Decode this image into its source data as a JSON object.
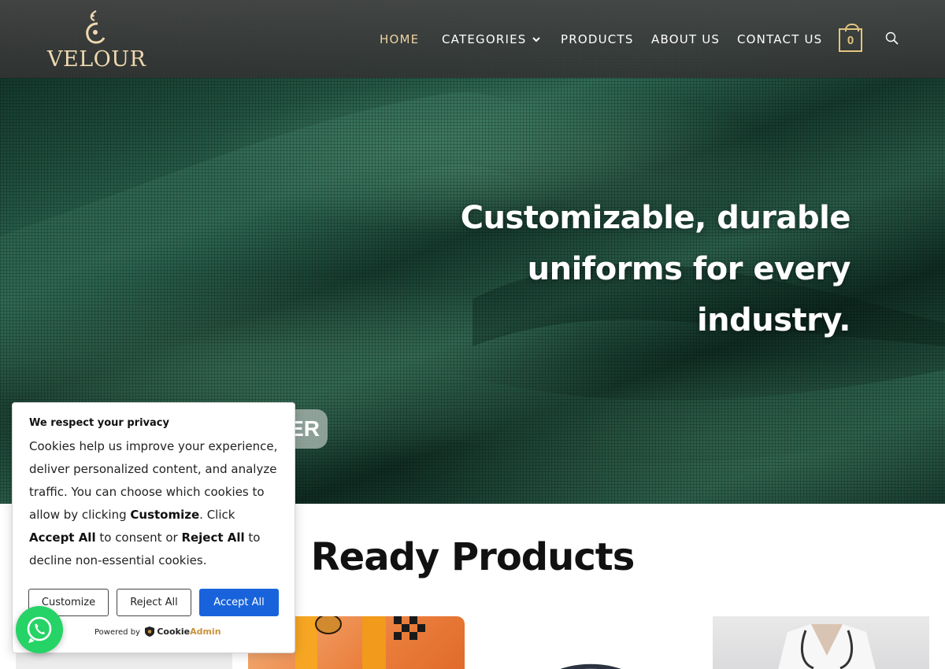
{
  "brand": {
    "name": "VELOUR"
  },
  "nav": {
    "items": [
      {
        "label": "HOME"
      },
      {
        "label": "CATEGORIES"
      },
      {
        "label": "PRODUCTS"
      },
      {
        "label": "ABOUT US"
      },
      {
        "label": "CONTACT US"
      }
    ],
    "cart_count": "0"
  },
  "hero": {
    "headline": "Customizable, durable uniforms for every industry.",
    "button_label_visible": "ER"
  },
  "products": {
    "title": "Ready Products"
  },
  "cookie": {
    "title": "We respect your privacy",
    "body_part1": "Cookies help us improve your experience, deliver personalized content, and analyze traffic. You can choose which cookies to allow by clicking ",
    "customize_word": "Customize",
    "body_part2": ". Click ",
    "accept_all_word": "Accept All",
    "body_part3": " to consent or ",
    "reject_all_word": "Reject All",
    "body_part4": " to decline non-essential cookies.",
    "buttons": {
      "customize": "Customize",
      "reject": "Reject All",
      "accept": "Accept All"
    },
    "powered_by": "Powered by",
    "provider_a": "Cookie",
    "provider_b": "Admin"
  },
  "colors": {
    "accent_gold": "#ecd3a4",
    "cart_gold": "#e3c47f",
    "accept_blue": "#1863dc",
    "whatsapp_green": "#25d366"
  },
  "icons": {
    "logo": "velour-logo-mark",
    "search": "search-icon",
    "cart": "shopping-bag-icon",
    "whatsapp": "whatsapp-icon",
    "dropdown": "chevron-down-icon"
  }
}
